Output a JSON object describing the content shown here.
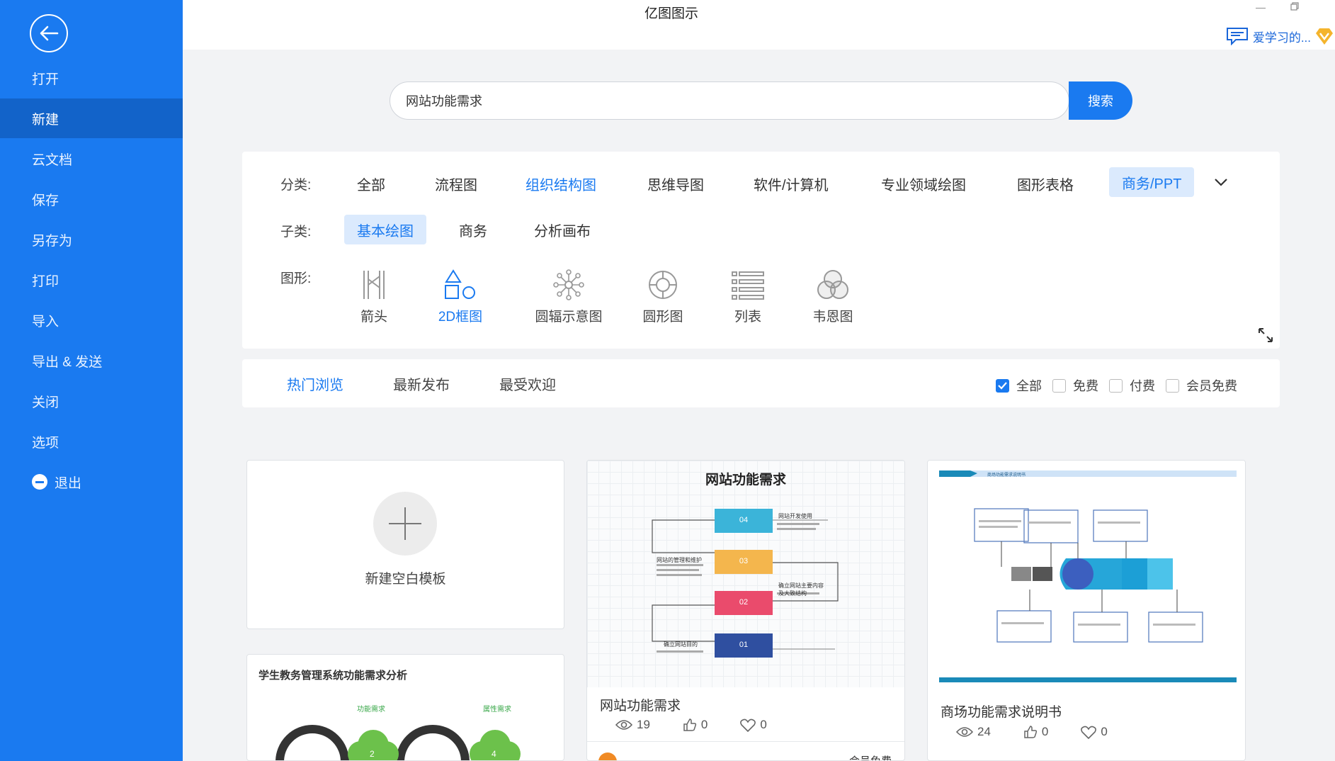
{
  "app": {
    "title": "亿图图示",
    "user_name": "爱学习的..."
  },
  "sidebar": {
    "items": [
      {
        "label": "打开"
      },
      {
        "label": "新建"
      },
      {
        "label": "云文档"
      },
      {
        "label": "保存"
      },
      {
        "label": "另存为"
      },
      {
        "label": "打印"
      },
      {
        "label": "导入"
      },
      {
        "label": "导出 & 发送"
      },
      {
        "label": "关闭"
      },
      {
        "label": "选项"
      },
      {
        "label": "退出"
      }
    ],
    "active": "新建"
  },
  "search": {
    "value": "网站功能需求",
    "button_label": "搜索"
  },
  "filters": {
    "category_label": "分类:",
    "categories": [
      "全部",
      "流程图",
      "组织结构图",
      "思维导图",
      "软件/计算机",
      "专业领域绘图",
      "图形表格",
      "商务/PPT"
    ],
    "subcategory_label": "子类:",
    "subcategories": [
      "基本绘图",
      "商务",
      "分析画布"
    ],
    "shape_label": "图形:",
    "shapes": [
      "箭头",
      "2D框图",
      "圆辐示意图",
      "圆形图",
      "列表",
      "韦恩图"
    ]
  },
  "sort": {
    "tabs": [
      "热门浏览",
      "最新发布",
      "最受欢迎"
    ],
    "checks": [
      {
        "label": "全部",
        "checked": true
      },
      {
        "label": "免费",
        "checked": false
      },
      {
        "label": "付费",
        "checked": false
      },
      {
        "label": "会员免费",
        "checked": false
      }
    ]
  },
  "cards": {
    "blank": {
      "label": "新建空白模板"
    },
    "card1": {
      "thumb_title": "网站功能需求",
      "title": "网站功能需求",
      "views": "19",
      "likes": "0",
      "favs": "0",
      "steps": [
        "04",
        "03",
        "02",
        "01"
      ],
      "labels": [
        "网站开发使用",
        "网站的管理和维护",
        "确立网站主要内容及大致结构",
        "确立网站目的"
      ]
    },
    "card2": {
      "thumb_title": "商场功能需求说明书",
      "title": "商场功能需求说明书",
      "views": "24",
      "likes": "0",
      "favs": "0"
    },
    "card3": {
      "thumb_title": "学生教务管理系统功能需求分析",
      "tag1": "功能需求",
      "tag2": "属性需求",
      "num1": "2",
      "num2": "4"
    },
    "card4_footer": "会员免费"
  }
}
